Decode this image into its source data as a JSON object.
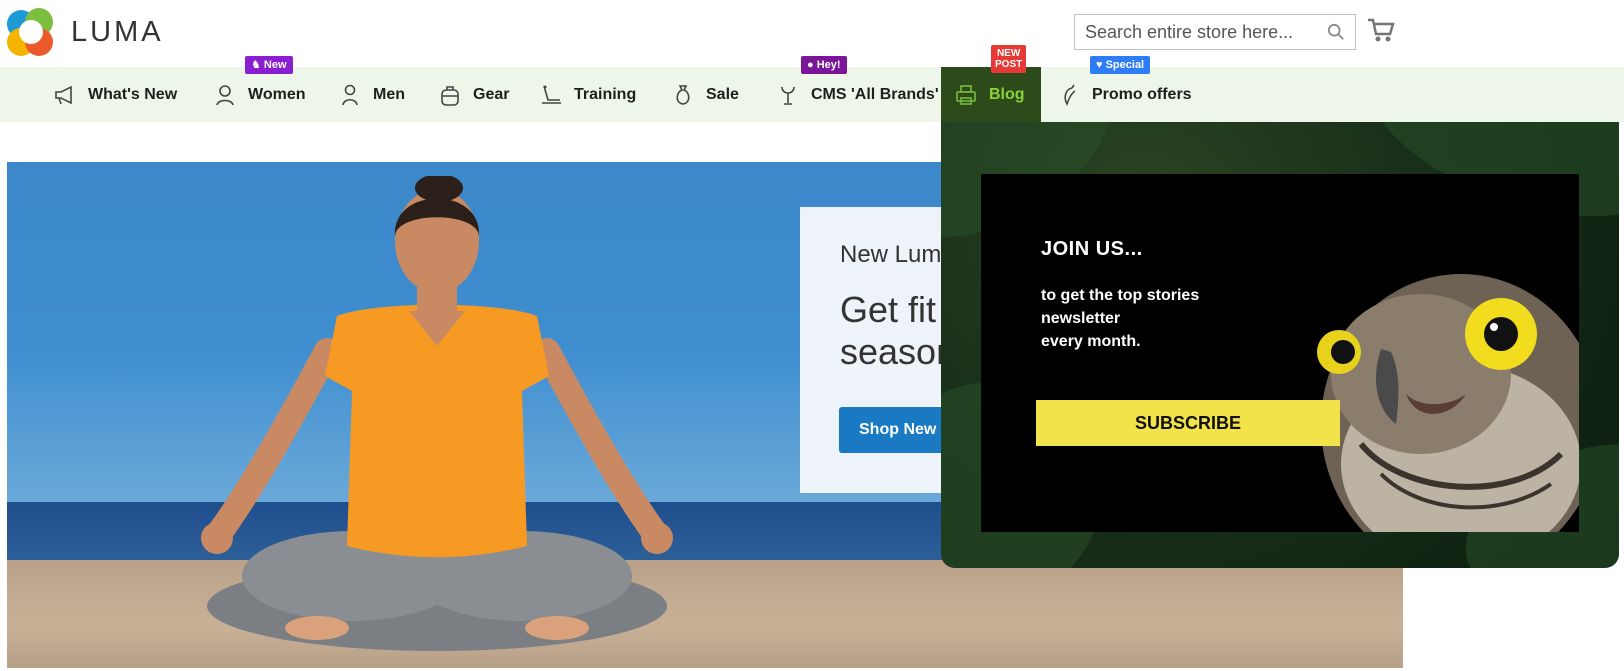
{
  "brand": {
    "name": "LUMA"
  },
  "search": {
    "placeholder": "Search entire store here..."
  },
  "nav": {
    "items": [
      {
        "label": "What's New"
      },
      {
        "label": "Women"
      },
      {
        "label": "Men"
      },
      {
        "label": "Gear"
      },
      {
        "label": "Training"
      },
      {
        "label": "Sale"
      },
      {
        "label": "CMS 'All Brands'"
      },
      {
        "label": "Blog"
      },
      {
        "label": "Promo offers"
      }
    ],
    "badges": {
      "women": "New",
      "cms": "Hey!",
      "blog_line1": "NEW",
      "blog_line2": "POST",
      "promo": "Special"
    }
  },
  "hero": {
    "kicker": "New Lum",
    "headline_line1": "Get fit",
    "headline_line2": "season",
    "button": "Shop New Y"
  },
  "newsletter": {
    "title": "JOIN US...",
    "line1": "to get the top stories",
    "line2": "newsletter",
    "line3": "every month.",
    "button": "SUBSCRIBE"
  },
  "colors": {
    "nav_bg": "#eef6ea",
    "blog_active_bg": "#2c4a1a",
    "blog_active_text": "#8bd33c",
    "shop_button": "#1979c3",
    "subscribe_button": "#f2e34a"
  }
}
